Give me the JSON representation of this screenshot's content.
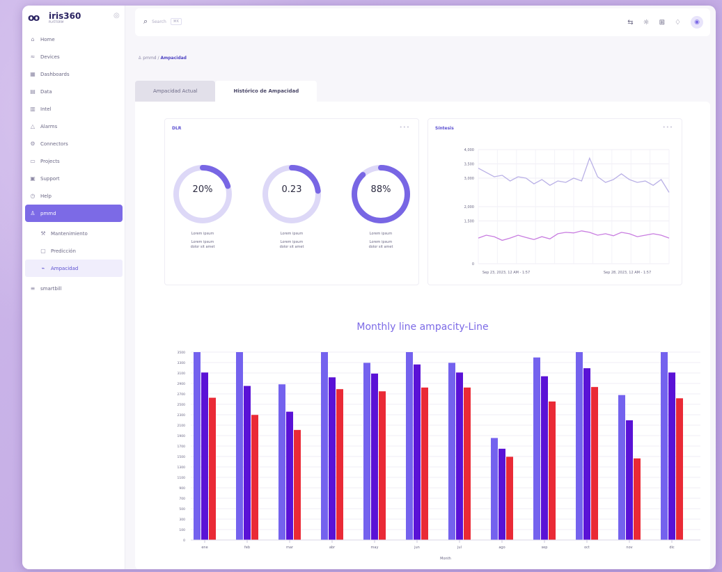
{
  "app": {
    "logo_mark": "oo",
    "logo_word": "iris360",
    "logo_tag": "PLATFORM"
  },
  "sidebar": {
    "items": [
      {
        "label": "Home",
        "icon": "home-icon"
      },
      {
        "label": "Devices",
        "icon": "wifi-icon"
      },
      {
        "label": "Dashboards",
        "icon": "grid-icon"
      },
      {
        "label": "Data",
        "icon": "table-icon"
      },
      {
        "label": "Intel",
        "icon": "chart-icon"
      },
      {
        "label": "Alarms",
        "icon": "alert-icon"
      },
      {
        "label": "Connectors",
        "icon": "plug-icon"
      },
      {
        "label": "Projects",
        "icon": "folder-icon"
      },
      {
        "label": "Support",
        "icon": "support-icon"
      },
      {
        "label": "Help",
        "icon": "help-icon"
      },
      {
        "label": "pmmd",
        "icon": "user-icon"
      },
      {
        "label": "Mantenimiento",
        "icon": "wrench-icon"
      },
      {
        "label": "Predicción",
        "icon": "calendar-icon"
      },
      {
        "label": "Ampacidad",
        "icon": "pulse-icon"
      },
      {
        "label": "smartbill",
        "icon": "bill-icon"
      }
    ]
  },
  "topbar": {
    "search_placeholder": "Search",
    "search_shortcut": "⌘K"
  },
  "breadcrumb": {
    "root": "pmmd",
    "sep": "/",
    "current": "Ampacidad"
  },
  "tabs": [
    {
      "label": "Ampacidad Actual"
    },
    {
      "label": "Histórico de Ampacidad"
    }
  ],
  "kpi_card": {
    "title": "DLR",
    "gauges": [
      {
        "value": "20%",
        "fraction": 0.2,
        "label": "Lorem ipsum",
        "desc1": "Lorem ipsum",
        "desc2": "dolor sit amet"
      },
      {
        "value": "0.23",
        "fraction": 0.23,
        "label": "Lorem ipsum",
        "desc1": "Lorem ipsum",
        "desc2": "dolor sit amet"
      },
      {
        "value": "88%",
        "fraction": 0.88,
        "label": "Lorem ipsum",
        "desc1": "Lorem ipsum",
        "desc2": "dolor sit amet"
      }
    ],
    "colors": {
      "track": "#ddd8f7",
      "fill": "#7866e4"
    }
  },
  "line_card": {
    "title": "Síntesis"
  },
  "bar_title": "Monthly line ampacity-Line",
  "chart_data": [
    {
      "type": "line",
      "title": "",
      "y_ticks": [
        "4,000",
        "3,500",
        "3,000",
        "2,000",
        "1,500",
        "0"
      ],
      "ylim": [
        0,
        4000
      ],
      "x_labels": [
        "Sep 23, 2023, 12 AM - 1:57",
        "Sep 28, 2023, 12 AM - 1:57"
      ],
      "series": [
        {
          "color": "#b9b0e6",
          "values": [
            3350,
            3200,
            3050,
            3100,
            2900,
            3050,
            3000,
            2800,
            2950,
            2750,
            2900,
            2850,
            3000,
            2900,
            3700,
            3050,
            2850,
            2950,
            3150,
            2950,
            2850,
            2900,
            2750,
            2950,
            2500
          ]
        },
        {
          "color": "#c87ce0",
          "values": [
            900,
            1000,
            950,
            820,
            900,
            1000,
            920,
            850,
            950,
            870,
            1050,
            1100,
            1080,
            1150,
            1100,
            1000,
            1050,
            980,
            1100,
            1050,
            950,
            1000,
            1050,
            1000,
            900
          ]
        }
      ],
      "grid": true
    },
    {
      "type": "bar",
      "title": "Monthly line ampacity-Line",
      "xlabel": "Month",
      "categories": [
        "ene",
        "feb",
        "mar",
        "abr",
        "may",
        "jun",
        "jul",
        "ago",
        "sep",
        "oct",
        "nov",
        "dic"
      ],
      "y_ticks": [
        "3500",
        "3300",
        "3100",
        "2900",
        "2700",
        "2500",
        "2300",
        "2100",
        "1900",
        "1700",
        "1500",
        "1300",
        "1100",
        "900",
        "700",
        "500",
        "300",
        "100",
        "0"
      ],
      "ylim": [
        0,
        3500
      ],
      "series": [
        {
          "color": "#7462ee",
          "values": [
            3500,
            3500,
            2900,
            3500,
            3300,
            3500,
            3300,
            1900,
            3400,
            3500,
            2700,
            3500
          ]
        },
        {
          "color": "#5a12d6",
          "values": [
            3120,
            2870,
            2390,
            3030,
            3100,
            3270,
            3120,
            1700,
            3050,
            3200,
            2230,
            3120
          ]
        },
        {
          "color": "#ea2a36",
          "values": [
            2650,
            2330,
            2050,
            2810,
            2770,
            2840,
            2840,
            1550,
            2580,
            2850,
            1520,
            2640
          ]
        }
      ],
      "grid": true,
      "legend": "none"
    }
  ]
}
